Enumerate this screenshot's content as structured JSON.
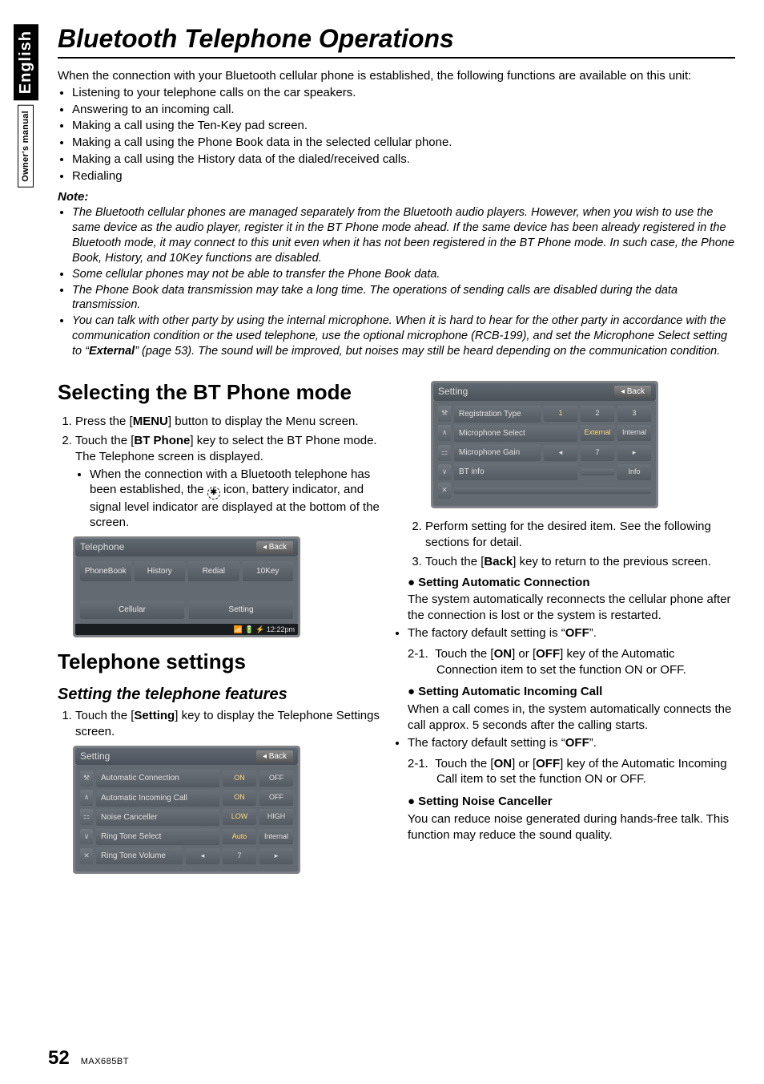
{
  "side": {
    "lang": "English",
    "manual": "Owner's manual"
  },
  "title": "Bluetooth Telephone Operations",
  "intro_lead": "When the connection with your Bluetooth cellular phone is established, the following functions are available on this unit:",
  "intro_bullets": [
    "Listening to your telephone calls on the car speakers.",
    "Answering to an incoming call.",
    "Making a call using the Ten-Key pad screen.",
    "Making a call using the Phone Book data in the selected cellular phone.",
    "Making a call using the History data of the dialed/received calls.",
    "Redialing"
  ],
  "note_head": "Note:",
  "notes": [
    "The Bluetooth cellular phones are managed separately from the Bluetooth audio players. However, when you wish to use the same device as the audio player, register it in the BT Phone mode ahead. If the same device has been already registered in the Bluetooth mode, it may connect to this unit even when it has not been registered in the BT Phone mode. In such case, the Phone Book, History, and 10Key functions are disabled.",
    "Some cellular phones may not be able to transfer the Phone Book data.",
    "The Phone Book data transmission may take a long time. The operations of sending calls are disabled during the data transmission.",
    "You can talk with other party by using the internal microphone. When it is hard to hear for the other party in accordance with the communication condition or the used telephone, use the optional microphone (RCB-199), and set the Microphone Select setting to “External” (page 53). The sound will be improved, but noises may still be heard depending on the communication condition."
  ],
  "note4_bold": "External",
  "left": {
    "h2": "Selecting the BT Phone mode",
    "step1": "Press the [MENU] button to display the Menu screen.",
    "step1_bold": "MENU",
    "step2a": "Touch the [BT Phone] key to select the BT Phone mode.",
    "step2_bold": "BT Phone",
    "step2b": "The Telephone screen is displayed.",
    "step2_bullet": "When the connection with a Bluetooth telephone has been established, the       icon, battery indicator, and signal level indicator are displayed at the bottom of the screen.",
    "h2b": "Telephone settings",
    "subhead": "Setting the telephone features",
    "tf_step1": "Touch the [Setting] key to display the Telephone Settings screen.",
    "tf_step1_bold": "Setting"
  },
  "right": {
    "r_step2": "Perform setting for the desired item. See the following sections for detail.",
    "r_step3": "Touch the [Back] key to return to the previous screen.",
    "r_step3_bold": "Back",
    "b1": "Setting Automatic Connection",
    "b1_text": "The system automatically reconnects the cellular phone after the connection is lost or the system is restarted.",
    "b1_bullet": "The factory default setting is “OFF”.",
    "b1_bullet_bold": "OFF",
    "b1_21": "Touch the [ON] or [OFF] key of the Automatic Connection item to set the function ON or OFF.",
    "b1_21_bold_on": "ON",
    "b1_21_bold_off": "OFF",
    "b2": "Setting Automatic Incoming Call",
    "b2_text": "When a call comes in, the system automatically connects the call approx. 5 seconds after the calling starts.",
    "b2_bullet": "The factory default setting is “OFF”.",
    "b2_bullet_bold": "OFF",
    "b2_21": "Touch the [ON] or [OFF] key of the Automatic Incoming Call item to set the function ON or OFF.",
    "b2_21_bold_on": "ON",
    "b2_21_bold_off": "OFF",
    "b3": "Setting Noise Canceller",
    "b3_text": "You can reduce noise generated during hands-free talk. This function may reduce the sound quality."
  },
  "shot_tel": {
    "title": "Telephone",
    "back": "◂ Back",
    "btns": [
      "PhoneBook",
      "History",
      "Redial",
      "10Key"
    ],
    "bottom": [
      "Cellular",
      "Setting"
    ],
    "status": "📶 🔋 ⚡ 12:22pm"
  },
  "shot_set1": {
    "title": "Setting",
    "back": "◂ Back",
    "rows": [
      {
        "side": "⚒",
        "label": "Automatic Connection",
        "opts": [
          "ON",
          "OFF"
        ],
        "active": 0
      },
      {
        "side": "∧",
        "label": "Automatic Incoming Call",
        "opts": [
          "ON",
          "OFF"
        ],
        "active": 0
      },
      {
        "side": "⚏",
        "label": "Noise Canceller",
        "opts": [
          "LOW",
          "HIGH"
        ],
        "active": 0
      },
      {
        "side": "∨",
        "label": "Ring Tone Select",
        "opts": [
          "Auto",
          "Internal"
        ],
        "active": 0
      },
      {
        "side": "✕",
        "label": "Ring Tone Volume",
        "opts": [
          "◂",
          "7",
          "▸"
        ],
        "active": -1
      }
    ]
  },
  "shot_set2": {
    "title": "Setting",
    "back": "◂ Back",
    "rows": [
      {
        "side": "⚒",
        "label": "Registration Type",
        "opts": [
          "1",
          "2",
          "3"
        ],
        "active": 0
      },
      {
        "side": "∧",
        "label": "Microphone Select",
        "opts": [
          "External",
          "Internal"
        ],
        "active": 0
      },
      {
        "side": "⚏",
        "label": "Microphone Gain",
        "opts": [
          "◂",
          "7",
          "▸"
        ],
        "active": -1
      },
      {
        "side": "∨",
        "label": "BT info",
        "opts": [
          "",
          "Info"
        ],
        "active": -1
      },
      {
        "side": "✕",
        "label": "",
        "opts": [],
        "active": -1
      }
    ]
  },
  "footer": {
    "page": "52",
    "model": "MAX685BT"
  }
}
